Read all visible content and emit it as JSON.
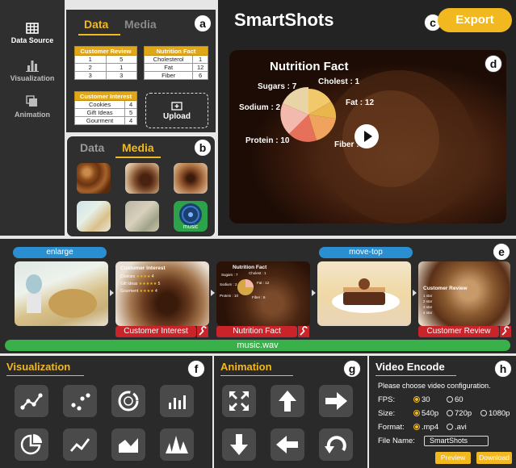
{
  "sidebar": {
    "items": [
      {
        "label": "Data Source",
        "icon": "table-icon"
      },
      {
        "label": "Visualization",
        "icon": "bar-chart-icon"
      },
      {
        "label": "Animation",
        "icon": "layers-icon"
      }
    ]
  },
  "data_panel": {
    "tabs": [
      "Data",
      "Media"
    ],
    "badge": "a",
    "customer_review": {
      "title": "Customer Review",
      "rows": [
        [
          "1",
          "5"
        ],
        [
          "2",
          "1"
        ],
        [
          "3",
          "3"
        ]
      ]
    },
    "nutrition_fact": {
      "title": "Nutrition Fact",
      "rows": [
        [
          "Cholesterol",
          "1"
        ],
        [
          "Fat",
          "12"
        ],
        [
          "Fiber",
          "6"
        ]
      ]
    },
    "customer_interest": {
      "title": "Customer Interest",
      "rows": [
        [
          "Cookies",
          "4"
        ],
        [
          "Gift Ideas",
          "5"
        ],
        [
          "Gourment",
          "4"
        ]
      ]
    },
    "upload_label": "Upload"
  },
  "media_panel": {
    "tabs": [
      "Data",
      "Media"
    ],
    "badge": "b",
    "music_label": "music"
  },
  "main": {
    "title": "SmartShots",
    "badge_c": "c",
    "export_label": "Export",
    "badge_d": "d",
    "preview": {
      "chart_title": "Nutrition Fact",
      "labels": [
        "Sugars : 7",
        "Cholest : 1",
        "Sodium : 2",
        "Fat : 12",
        "Protein : 10",
        "Fiber : 6"
      ]
    }
  },
  "timeline": {
    "badge": "e",
    "animations": [
      "enlarge",
      "move-top"
    ],
    "frame_labels": [
      "Customer Interest",
      "Nutrition Fact",
      "Customer Review"
    ],
    "frame1_title": "Customer Interest",
    "frame1_rows": [
      [
        "Cookies",
        "4"
      ],
      [
        "Gift Ideas",
        "5"
      ],
      [
        "Gourment",
        "4"
      ]
    ],
    "frame2_title": "Nutrition Fact",
    "frame2_labels": [
      "Sugars : 7",
      "Cholest : 1",
      "Sodium : 2",
      "Fat : 12",
      "Protein : 10",
      "Fiber : 6"
    ],
    "frame4_title": "Customer Review",
    "frame4_rows": [
      "1 star",
      "2 star",
      "3 star",
      "4 star"
    ],
    "audio": "music.wav"
  },
  "visualization": {
    "title": "Visualization",
    "badge": "f",
    "icons": [
      "line-scatter-icon",
      "scatter-icon",
      "donut-chart-icon",
      "bar-chart-icon",
      "pie-chart-icon",
      "line-chart-icon",
      "area-chart-icon",
      "peak-chart-icon"
    ]
  },
  "animation": {
    "title": "Animation",
    "badge": "g",
    "icons": [
      "expand-icon",
      "arrow-up-icon",
      "arrow-right-icon",
      "arrow-down-icon",
      "arrow-left-icon",
      "rotate-icon"
    ]
  },
  "video_encode": {
    "title": "Video Encode",
    "badge": "h",
    "prompt": "Please choose video configuration.",
    "fps_label": "FPS:",
    "fps_options": [
      "30",
      "60"
    ],
    "fps_selected": "30",
    "size_label": "Size:",
    "size_options": [
      "540p",
      "720p",
      "1080p"
    ],
    "size_selected": "540p",
    "format_label": "Format:",
    "format_options": [
      ".mp4",
      ".avi"
    ],
    "format_selected": ".mp4",
    "filename_label": "File Name:",
    "filename_value": "SmartShots",
    "preview_label": "Preview",
    "download_label": "Download"
  },
  "colors": {
    "accent": "#f2b81f",
    "panel": "#2f2f2f",
    "timeline_blue": "#2a8fd0",
    "timeline_red": "#c8242a",
    "audio_green": "#3ab04a"
  }
}
